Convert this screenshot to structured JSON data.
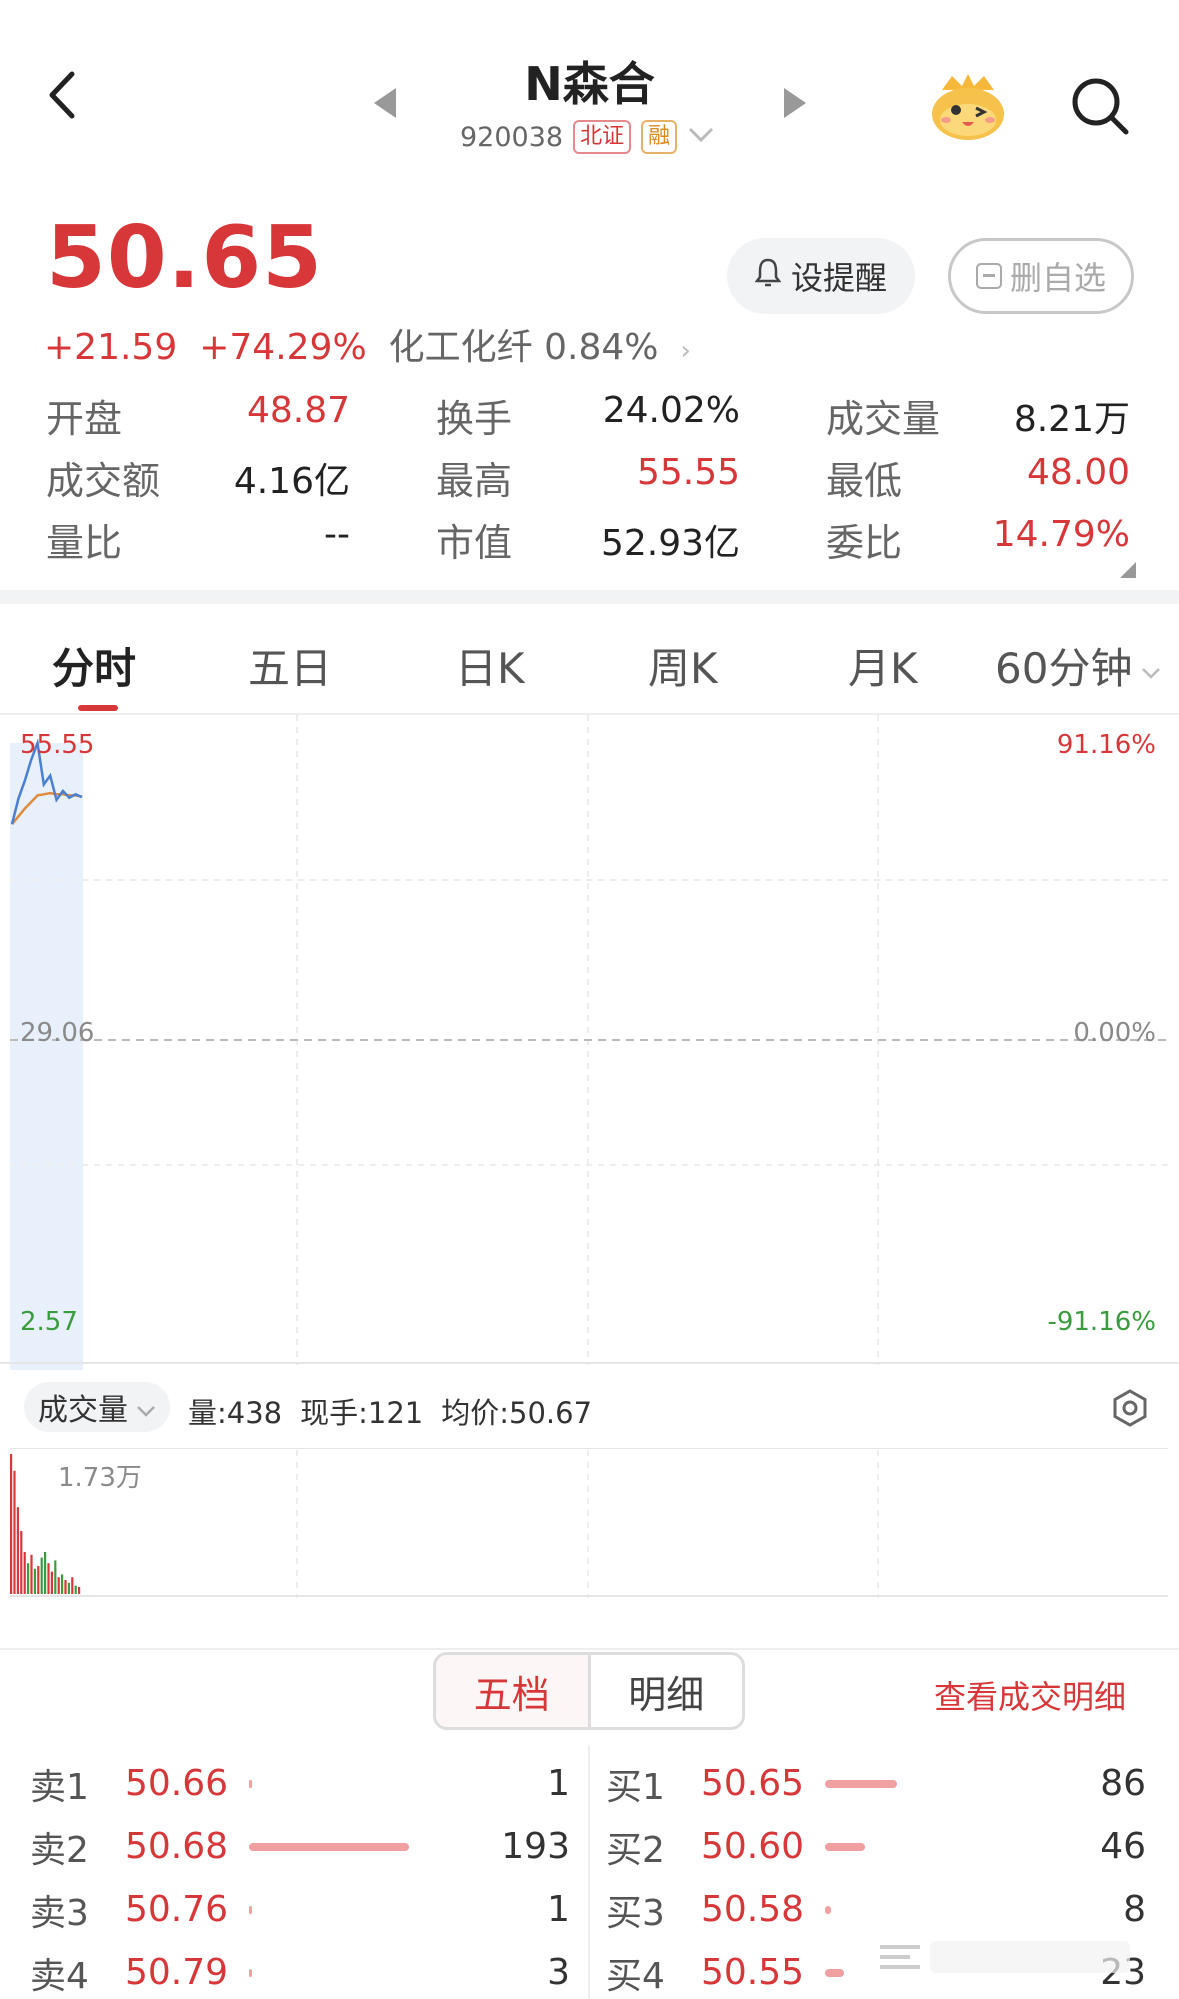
{
  "header": {
    "title": "N森合",
    "code": "920038",
    "tag_exchange": "北证",
    "tag_margin": "融"
  },
  "quote": {
    "price": "50.65",
    "change": "+21.59",
    "change_pct": "+74.29%",
    "sector": "化工化纤 0.84%",
    "alert_label": "设提醒",
    "remove_label": "删自选"
  },
  "stats": [
    {
      "label": "开盘",
      "value": "48.87",
      "color": "#d8373a"
    },
    {
      "label": "换手",
      "value": "24.02%",
      "color": "#222222"
    },
    {
      "label": "成交量",
      "value": "8.21万",
      "color": "#222222"
    },
    {
      "label": "成交额",
      "value": "4.16亿",
      "color": "#222222"
    },
    {
      "label": "最高",
      "value": "55.55",
      "color": "#d8373a"
    },
    {
      "label": "最低",
      "value": "48.00",
      "color": "#d8373a"
    },
    {
      "label": "量比",
      "value": "--",
      "color": "#222222"
    },
    {
      "label": "市值",
      "value": "52.93亿",
      "color": "#222222"
    },
    {
      "label": "委比",
      "value": "14.79%",
      "color": "#d8373a"
    }
  ],
  "tabs": [
    "分时",
    "五日",
    "日K",
    "周K",
    "月K",
    "60分钟"
  ],
  "chart": {
    "y_top": "55.55",
    "y_mid": "29.06",
    "y_bottom": "2.57",
    "pct_top": "91.16%",
    "pct_mid": "0.00%",
    "pct_bottom": "-91.16%"
  },
  "chart_data": {
    "type": "line",
    "ylim": [
      2.57,
      55.55
    ],
    "series": [
      {
        "values": [
          48.2,
          50.5,
          52.1,
          54.0,
          55.55,
          51.8,
          52.6,
          50.4,
          51.2,
          50.6,
          50.9,
          50.65
        ]
      },
      {
        "values": [
          48.2,
          48.9,
          49.6,
          50.2,
          50.8,
          50.9,
          51.0,
          50.9,
          50.9,
          50.8,
          50.8,
          50.7
        ]
      }
    ]
  },
  "volume": {
    "selector": "成交量",
    "info": [
      "量:438",
      "现手:121",
      "均价:50.67"
    ],
    "max_label": "1.73万",
    "bars": [
      1.0,
      0.88,
      0.62,
      0.45,
      0.3,
      0.22,
      0.28,
      0.18,
      0.2,
      0.26,
      0.3,
      0.22,
      0.16,
      0.24,
      0.12,
      0.14,
      0.1,
      0.08,
      0.12,
      0.06,
      0.05
    ],
    "bar_colors": [
      "red",
      "red",
      "red",
      "red",
      "red",
      "green",
      "red",
      "green",
      "red",
      "green",
      "green",
      "red",
      "red",
      "green",
      "red",
      "green",
      "red",
      "green",
      "red",
      "green",
      "red"
    ]
  },
  "orderbook": {
    "tab_five": "五档",
    "tab_detail": "明细",
    "view_detail": "查看成交明细",
    "sell": [
      {
        "label": "卖1",
        "price": "50.66",
        "qty": "1",
        "ratio": 0.02
      },
      {
        "label": "卖2",
        "price": "50.68",
        "qty": "193",
        "ratio": 1.0
      },
      {
        "label": "卖3",
        "price": "50.76",
        "qty": "1",
        "ratio": 0.02
      },
      {
        "label": "卖4",
        "price": "50.79",
        "qty": "3",
        "ratio": 0.02
      }
    ],
    "buy": [
      {
        "label": "买1",
        "price": "50.65",
        "qty": "86",
        "ratio": 0.45
      },
      {
        "label": "买2",
        "price": "50.60",
        "qty": "46",
        "ratio": 0.25
      },
      {
        "label": "买3",
        "price": "50.58",
        "qty": "8",
        "ratio": 0.04
      },
      {
        "label": "买4",
        "price": "50.55",
        "qty": "23",
        "ratio": 0.12
      }
    ]
  }
}
